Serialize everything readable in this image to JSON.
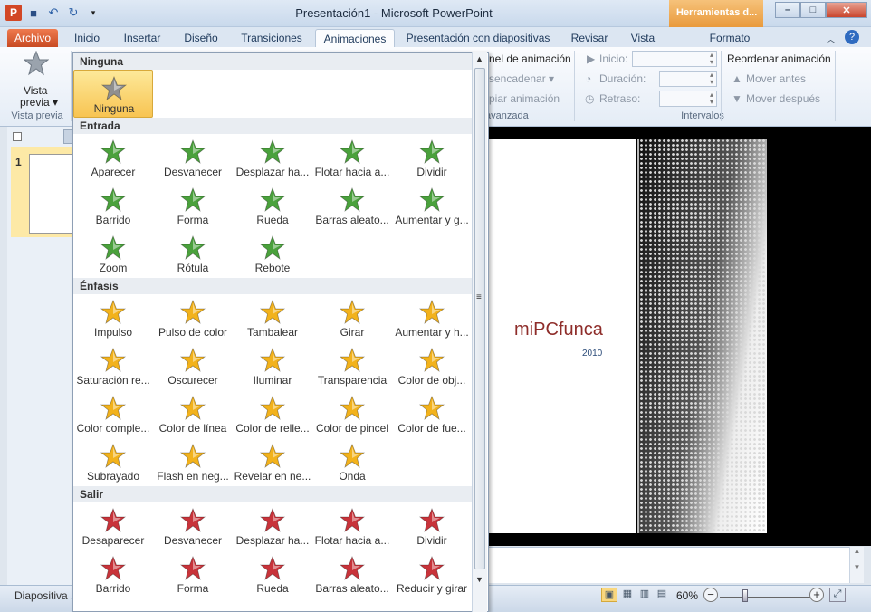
{
  "window": {
    "title": "Presentación1 - Microsoft PowerPoint",
    "context_tab": "Herramientas d...",
    "minimize": "–",
    "maximize": "□",
    "close": "✕"
  },
  "tabs": [
    {
      "label": "Archivo"
    },
    {
      "label": "Inicio"
    },
    {
      "label": "Insertar"
    },
    {
      "label": "Diseño"
    },
    {
      "label": "Transiciones"
    },
    {
      "label": "Animaciones"
    },
    {
      "label": "Presentación con diapositivas"
    },
    {
      "label": "Revisar"
    },
    {
      "label": "Vista"
    },
    {
      "label": "Formato"
    }
  ],
  "ribbon": {
    "preview_label": "Vista previa",
    "preview_btn": "Vista",
    "preview_btn2": "previa ▾",
    "panel_label": "nel de animación",
    "trigger_label": "sencadenar ▾",
    "copy_label": "piar animación",
    "advanced_label": "avanzada",
    "start_label": "Inicio:",
    "duration_label": "Duración:",
    "delay_label": "Retraso:",
    "intervals_label": "Intervalos",
    "reorder_label": "Reordenar animación",
    "move_earlier": "Mover antes",
    "move_later": "Mover después"
  },
  "slides_pane": {
    "slide_number": "1"
  },
  "slide": {
    "title": "miPCfunca",
    "subtitle": "2010"
  },
  "status": {
    "slide_info": "Diapositiva 1",
    "zoom": "60%"
  },
  "gallery": {
    "sections": [
      {
        "title": "Ninguna",
        "items": [
          {
            "label": "Ninguna",
            "color": "gray"
          }
        ]
      },
      {
        "title": "Entrada",
        "items": [
          {
            "label": "Aparecer",
            "color": "green"
          },
          {
            "label": "Desvanecer",
            "color": "green"
          },
          {
            "label": "Desplazar ha...",
            "color": "green"
          },
          {
            "label": "Flotar hacia a...",
            "color": "green"
          },
          {
            "label": "Dividir",
            "color": "green"
          },
          {
            "label": "Barrido",
            "color": "green"
          },
          {
            "label": "Forma",
            "color": "green"
          },
          {
            "label": "Rueda",
            "color": "green"
          },
          {
            "label": "Barras aleato...",
            "color": "green"
          },
          {
            "label": "Aumentar y g...",
            "color": "green"
          },
          {
            "label": "Zoom",
            "color": "green"
          },
          {
            "label": "Rótula",
            "color": "green"
          },
          {
            "label": "Rebote",
            "color": "green"
          }
        ]
      },
      {
        "title": "Énfasis",
        "items": [
          {
            "label": "Impulso",
            "color": "gold"
          },
          {
            "label": "Pulso de color",
            "color": "gold"
          },
          {
            "label": "Tambalear",
            "color": "gold"
          },
          {
            "label": "Girar",
            "color": "gold"
          },
          {
            "label": "Aumentar y h...",
            "color": "gold"
          },
          {
            "label": "Saturación re...",
            "color": "gold"
          },
          {
            "label": "Oscurecer",
            "color": "gold"
          },
          {
            "label": "Iluminar",
            "color": "gold"
          },
          {
            "label": "Transparencia",
            "color": "gold"
          },
          {
            "label": "Color de obj...",
            "color": "gold"
          },
          {
            "label": "Color comple...",
            "color": "gold"
          },
          {
            "label": "Color de línea",
            "color": "gold"
          },
          {
            "label": "Color de relle...",
            "color": "gold"
          },
          {
            "label": "Color de pincel",
            "color": "gold"
          },
          {
            "label": "Color de fue...",
            "color": "gold"
          },
          {
            "label": "Subrayado",
            "color": "gold"
          },
          {
            "label": "Flash en neg...",
            "color": "gold"
          },
          {
            "label": "Revelar en ne...",
            "color": "gold"
          },
          {
            "label": "Onda",
            "color": "gold"
          }
        ]
      },
      {
        "title": "Salir",
        "items": [
          {
            "label": "Desaparecer",
            "color": "red"
          },
          {
            "label": "Desvanecer",
            "color": "red"
          },
          {
            "label": "Desplazar ha...",
            "color": "red"
          },
          {
            "label": "Flotar hacia a...",
            "color": "red"
          },
          {
            "label": "Dividir",
            "color": "red"
          },
          {
            "label": "Barrido",
            "color": "red"
          },
          {
            "label": "Forma",
            "color": "red"
          },
          {
            "label": "Rueda",
            "color": "red"
          },
          {
            "label": "Barras aleato...",
            "color": "red"
          },
          {
            "label": "Reducir y girar",
            "color": "red"
          }
        ]
      }
    ]
  },
  "colors": {
    "green": "#4aa13c",
    "gold": "#f2b21c",
    "red": "#c8333a",
    "gray": "#8f8f8f"
  }
}
